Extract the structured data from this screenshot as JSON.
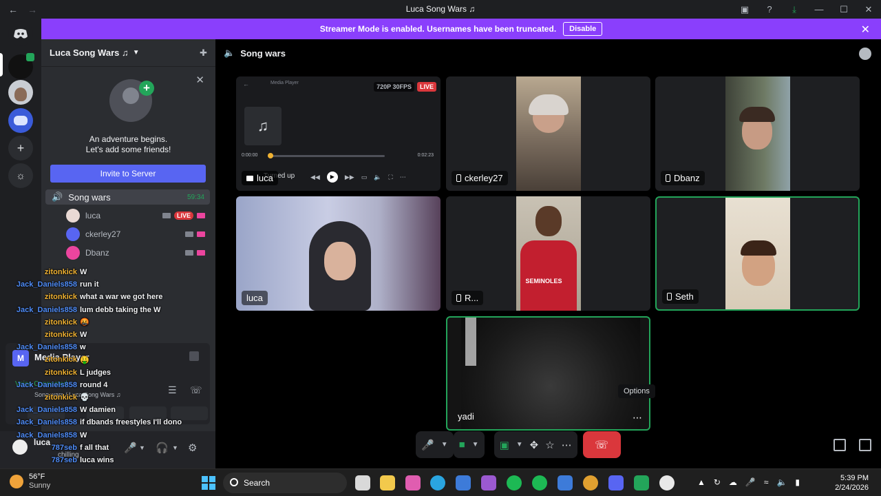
{
  "window": {
    "title": "Luca Song Wars ♫"
  },
  "banner": {
    "text": "Streamer Mode is enabled. Usernames have been truncated.",
    "button": "Disable"
  },
  "server": {
    "name": "Luca Song Wars ♫",
    "friend_card_line1": "An adventure begins.",
    "friend_card_line2": "Let's add some friends!",
    "invite_button": "Invite to Server"
  },
  "voice_channel": {
    "name": "Song wars",
    "elapsed": "59:34",
    "users": [
      {
        "name": "luca",
        "live": "LIVE"
      },
      {
        "name": "ckerley27"
      },
      {
        "name": "Dbanz"
      }
    ]
  },
  "overlay_chat": [
    {
      "user": "zitonkick",
      "msg": "W"
    },
    {
      "user": "Jack_Daniels858",
      "msg": "run it"
    },
    {
      "user": "zitonkick",
      "msg": "what a war we got here"
    },
    {
      "user": "Jack_Daniels858",
      "msg": "lum debb taking the W"
    },
    {
      "user": "zitonkick",
      "msg": "🤬"
    },
    {
      "user": "zitonkick",
      "msg": "W"
    },
    {
      "user": "Jack_Daniels858",
      "msg": "w"
    },
    {
      "user": "zitonkick",
      "msg": "🤑"
    },
    {
      "user": "zitonkick",
      "msg": "L judges"
    },
    {
      "user": "Jack_Daniels858",
      "msg": "round 4"
    },
    {
      "user": "zitonkick",
      "msg": "💀"
    },
    {
      "user": "Jack_Daniels858",
      "msg": "W damien"
    },
    {
      "user": "Jack_Daniels858",
      "msg": "if dbands freestyles I'll dono"
    },
    {
      "user": "Jack_Daniels858",
      "msg": "W"
    },
    {
      "user": "787seb",
      "msg": "f all that"
    },
    {
      "user": "787seb",
      "msg": "luca wins"
    }
  ],
  "media_panel": {
    "title": "Media Player",
    "voice_status": "Voice Connected",
    "sub": "Song wars / Luca Song Wars ♫"
  },
  "user_area": {
    "name": "luca",
    "status": "chilling"
  },
  "main": {
    "channel_name": "Song wars",
    "tiles": [
      {
        "id": "stream",
        "label": "luca",
        "quality": "720P 30FPS",
        "live": "LIVE",
        "app_title": "Media Player",
        "time_start": "0:00:00",
        "time_end": "0:02:23",
        "caption": "Turned up"
      },
      {
        "id": "ckerley27",
        "label": "ckerley27"
      },
      {
        "id": "dbanz",
        "label": "Dbanz"
      },
      {
        "id": "luca-cam",
        "label": "luca"
      },
      {
        "id": "r",
        "label": "R..."
      },
      {
        "id": "seth",
        "label": "Seth"
      },
      {
        "id": "yadi",
        "label": "yadi"
      }
    ],
    "options_tooltip": "Options"
  },
  "taskbar": {
    "temp": "56°F",
    "condition": "Sunny",
    "search_placeholder": "Search",
    "time": "5:39 PM",
    "date": "2/24/2026"
  },
  "colors": {
    "banner": "#8a3ffc",
    "blurple": "#5865f2",
    "speaking": "#23a55a",
    "live": "#da373c"
  }
}
